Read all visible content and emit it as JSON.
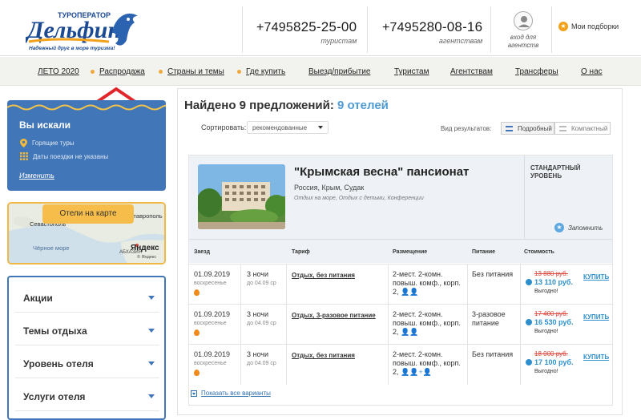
{
  "header": {
    "logo_top": "ТУРОПЕРАТОР",
    "logo_name": "Дельфин",
    "logo_slogan": "Надежный друг в море туризма!",
    "phone1_prefix": "+7495",
    "phone1_number": "825-25-00",
    "phone1_label": "туристам",
    "phone2_prefix": "+7495",
    "phone2_number": "280-08-16",
    "phone2_label": "агентствам",
    "login_label": "вход для агентств",
    "favorites_label": "Мои подборки"
  },
  "nav": {
    "items": [
      "ЛЕТО 2020",
      "Распродажа",
      "Страны и темы",
      "Где купить",
      "Выезд/прибытие",
      "Туристам",
      "Агентствам",
      "Трансферы",
      "О нас"
    ]
  },
  "sidebar": {
    "search_title": "Вы искали",
    "hot_tours": "Горящие туры",
    "dates": "Даты поездки не указаны",
    "change": "Изменить",
    "map_button": "Отели на карте",
    "map_labels": {
      "sevastopol": "Севастополь",
      "stavropol": "Ставрополь",
      "sea": "Чёрное море",
      "abkhazia": "АБХАЗИЯ",
      "yandex": "Яндекс",
      "yandex_small": "© Яндекс"
    },
    "accordion": [
      "Акции",
      "Темы отдыха",
      "Уровень отеля",
      "Услуги отеля"
    ]
  },
  "results": {
    "found_prefix": "Найдено 9 предложений:",
    "found_hotels": "9 отелей",
    "sort_label": "Сортировать:",
    "sort_value": "рекомендованные",
    "view_label": "Вид результатов:",
    "view_detailed": "Подробный",
    "view_compact": "Компактный"
  },
  "hotel": {
    "name": "\"Крымская весна\" пансионат",
    "location": "Россия, Крым, Судак",
    "tags": "Отдых на море, Отдых с детьми, Конференции",
    "level": "СТАНДАРТНЫЙ УРОВЕНЬ",
    "remember": "Запомнить",
    "columns": [
      "Заезд",
      "Тариф",
      "Размещение",
      "Питание",
      "Стоимость"
    ],
    "rows": [
      {
        "date": "01.09.2019",
        "weekday": "воскресенье",
        "nights": "3 ночи",
        "until": "до 04.09 ср",
        "tariff": "Отдых, без питания",
        "room": "2-мест. 2-комн. повыш. комф., корп. 2,",
        "guests": "👤👤",
        "meal": "Без питания",
        "old_price": "13 880 руб.",
        "price": "13 110 руб.",
        "note": "Выгодно!",
        "buy": "КУПИТЬ"
      },
      {
        "date": "01.09.2019",
        "weekday": "воскресенье",
        "nights": "3 ночи",
        "until": "до 04.09 ср",
        "tariff": "Отдых, 3-разовое питание",
        "room": "2-мест. 2-комн. повыш. комф., корп. 2,",
        "guests": "👤👤",
        "meal": "3-разовое питание",
        "old_price": "17 400 руб.",
        "price": "16 530 руб.",
        "note": "Выгодно!",
        "buy": "КУПИТЬ"
      },
      {
        "date": "01.09.2019",
        "weekday": "воскресенье",
        "nights": "3 ночи",
        "until": "до 04.09 ср",
        "tariff": "Отдых, без питания",
        "room": "2-мест. 2-комн. повыш. комф., корп. 2,",
        "guests": "👤👤+👤",
        "meal": "Без питания",
        "old_price": "18 000 руб.",
        "price": "17 100 руб.",
        "note": "Выгодно!",
        "buy": "КУПИТЬ"
      }
    ],
    "show_all": "Показать все варианты"
  }
}
